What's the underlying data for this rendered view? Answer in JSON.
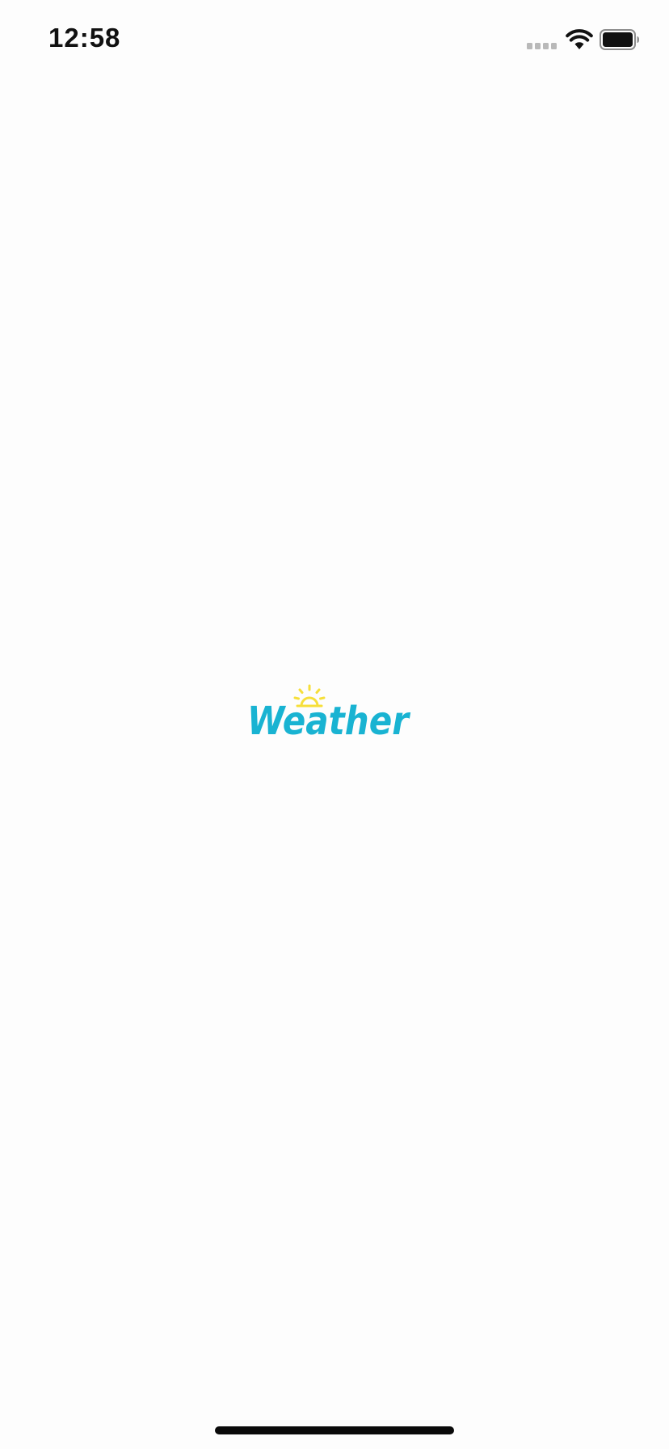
{
  "status_bar": {
    "time": "12:58"
  },
  "splash": {
    "logo_text": "Weather",
    "logo_color": "#19b3d2",
    "sun_color": "#f6df3a"
  },
  "icons": {
    "signal": "signal-bars-icon",
    "wifi": "wifi-icon",
    "battery": "battery-icon",
    "sun": "sun-icon"
  }
}
